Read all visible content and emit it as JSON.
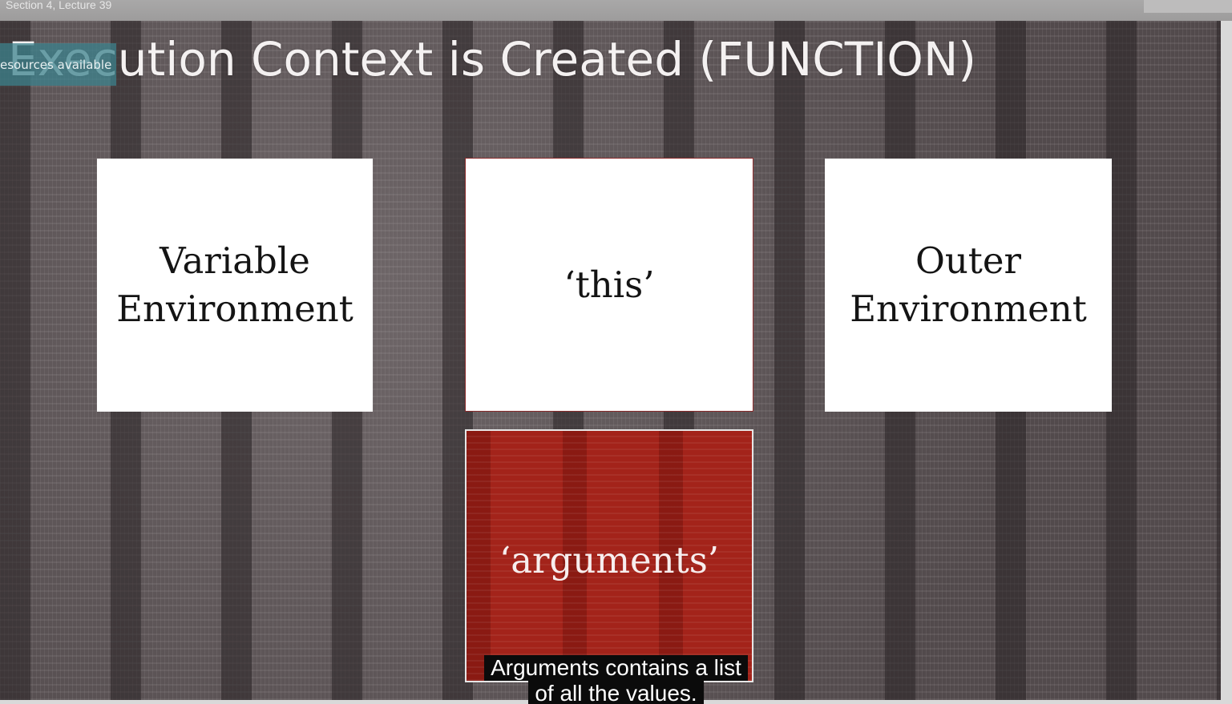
{
  "player": {
    "lecture_label": "Section 4, Lecture 39",
    "resources_badge": "esources available"
  },
  "slide": {
    "title": "Execution Context is Created (FUNCTION)",
    "cards": {
      "variable_environment": [
        "Variable",
        "Environment"
      ],
      "this": "‘this’",
      "outer_environment": [
        "Outer",
        "Environment"
      ],
      "arguments": "‘arguments’"
    }
  },
  "caption": {
    "line1": "Arguments contains a list",
    "line2": "of all the values."
  },
  "colors": {
    "slide_background": "#5c5456",
    "card_background": "#ffffff",
    "arguments_card": "#a3231a",
    "resources_badge": "#3c828c",
    "caption_background": "#0b0b0b"
  }
}
